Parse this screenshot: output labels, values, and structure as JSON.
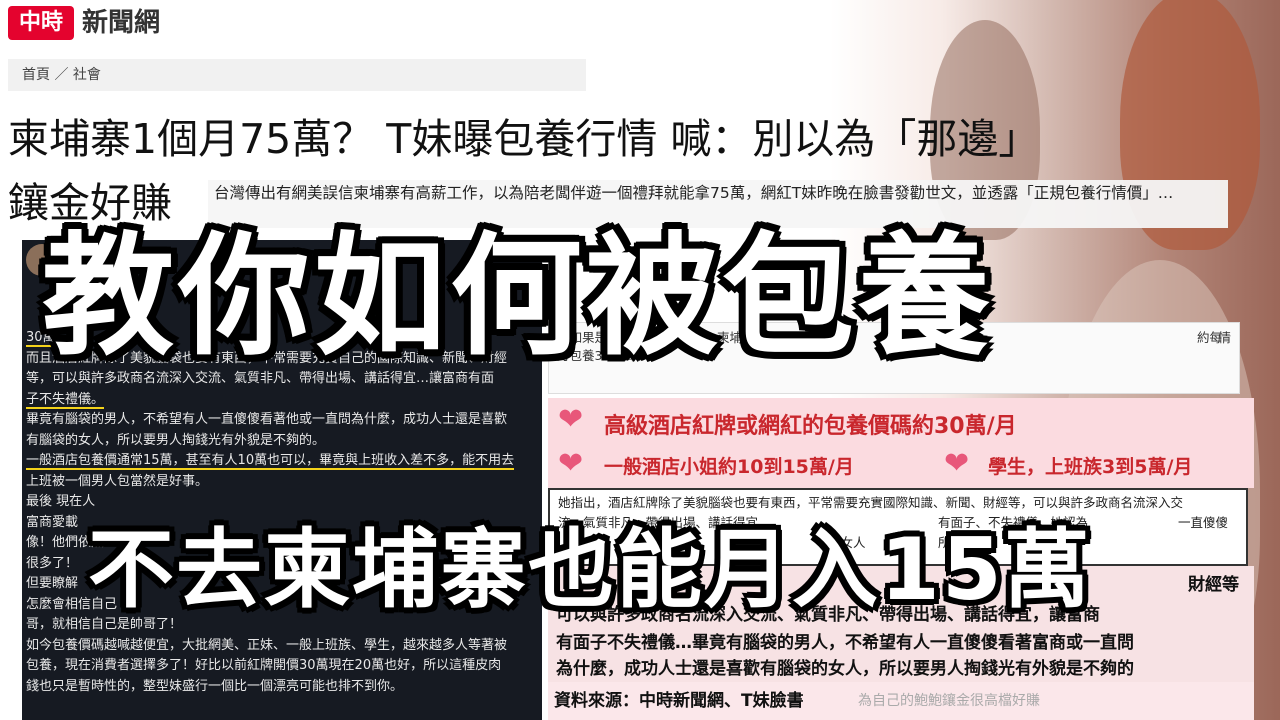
{
  "header": {
    "logo_mark": "中時",
    "logo_text": "新聞網",
    "breadcrumb": "首頁 ／ 社會",
    "headline_line1": "柬埔寨1個月75萬？ T妹曝包養行情 喊：別以為「那邊」",
    "headline_line2": "鑲金好賺"
  },
  "summary": {
    "text": "台灣傳出有網美誤信柬埔寨有高薪工作，以為陪老闆伴遊一個禮拜就能拿75萬，網紅T妹昨晚在臉書發勸世文，並透露「正規包養行情價」…"
  },
  "left_post": {
    "lines": [
      "有",
      "要",
      "很",
      "「",
      "30萬",
      "而且酒店紅牌除了美貌腦袋也要有東西，平常需要充實自己的國際知識、新聞、財經",
      "等，可以與許多政商名流深入交流、氣質非凡、帶得出場、講話得宜…讓富商有面",
      "子不失禮儀。",
      "畢竟有腦袋的男人，不希望有人一直傻傻看著他或一直問為什麼，成功人士還是喜歡",
      "有腦袋的女人，所以要男人掏錢光有外貌是不夠的。",
      "一般酒店包養價通常15萬，甚至有人10萬也可以，畢竟與上班收入差不多，能不用去",
      "上班被一個男人包當然是好事。",
      "最後 現在人",
      "富商愛載",
      "像！他們依然",
      "很多了！",
      "但要瞭解",
      "怎麼會相信自己",
      "哥，就相信自己是帥哥了！",
      "如今包養價碼越喊越便宜，大批網美、正妹、一般上班族、學生，越來越多人等著被",
      "包養，現在消費者選擇多了！好比以前紅牌開價30萬現在20萬也好，所以這種皮肉",
      "錢也只是暫時性的，整型妹盛行一個比一個漂亮可能也排不到你。"
    ]
  },
  "right_article": {
    "line1": "價如果是",
    "line1b": "柬埔寨",
    "line1c": "月收入",
    "line1d": "約每",
    "line2": "月包養3到5萬",
    "right_edge": "情"
  },
  "pink_callouts": {
    "item1": "高級酒店紅牌或網紅的包養價碼約30萬/月",
    "item2": "一般酒店小姐約10到15萬/月",
    "item3": "學生，上班族3到5萬/月"
  },
  "quote": {
    "line1": "她指出，酒店紅牌除了美貌腦袋也要有東西，平常需要充實國際知識、新聞、財經等，可以與許多政商名流深入交",
    "line2": "流、氣質非凡、帶得出場、講話得宜",
    "line2b": "有面子、不失禮儀。她認為",
    "line2c": "一直傻傻",
    "line3": "的女人",
    "line3b": "所以要男"
  },
  "pink_bottom": {
    "line0": "財經等",
    "line1": "可以與許多政商名流深入交流、氣質非凡、帶得出場、講話得宜，讓富商",
    "line2": "有面子不失禮儀…畢竟有腦袋的男人，不希望有人一直傻傻看著富商或一直問",
    "line3": "為什麼，成功人士還是喜歡有腦袋的女人，所以要男人掏錢光有外貌是不夠的"
  },
  "source": {
    "text": "資料來源：中時新聞網、T妹臉書",
    "faded": "為自己的鮑鮑鑲金很高檔好賺"
  },
  "overlay": {
    "big_title": "教你如何被包養",
    "big_subtitle": "不去柬埔寨也能月入15萬"
  },
  "colors": {
    "logo_red": "#e4032e",
    "callout_red": "#c9272d",
    "heart_pink": "#e8577a",
    "dark_bg": "#161a22",
    "highlight_yellow": "#f3d21a"
  }
}
